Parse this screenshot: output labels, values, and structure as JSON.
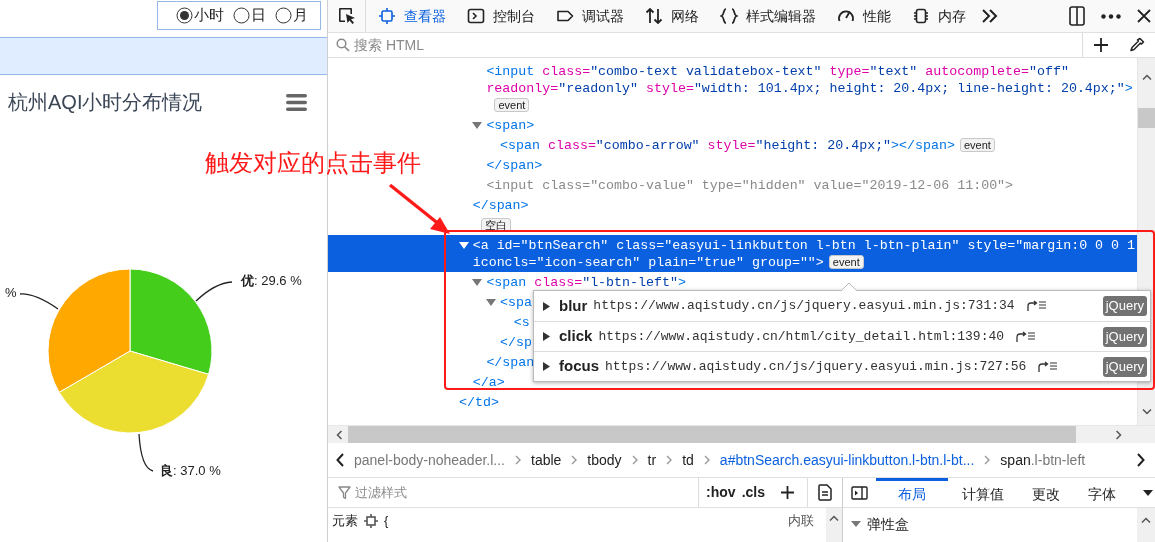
{
  "page": {
    "period_options": [
      {
        "label": "小时",
        "selected": true
      },
      {
        "label": "日",
        "selected": false
      },
      {
        "label": "月",
        "selected": false
      }
    ],
    "chart_title": "杭州AQI小时分布情况",
    "chart_data": {
      "type": "pie",
      "values": [
        29.6,
        37.0,
        33.4
      ],
      "colors": [
        "#44ce1b",
        "#ecdd31",
        "#ffa800"
      ]
    },
    "slice_labels": [
      "**优**: 29.6 %",
      "**良**: 37.0 %",
      "%"
    ]
  },
  "annotation": {
    "text": "触发对应的点击事件"
  },
  "devtools": {
    "tabs": [
      {
        "label": "查看器",
        "kind": "inspector",
        "selected": true
      },
      {
        "label": "控制台",
        "kind": "console",
        "selected": false
      },
      {
        "label": "调试器",
        "kind": "debugger",
        "selected": false
      },
      {
        "label": "网络",
        "kind": "network",
        "selected": false
      },
      {
        "label": "样式编辑器",
        "kind": "style",
        "selected": false
      },
      {
        "label": "性能",
        "kind": "performance",
        "selected": false
      },
      {
        "label": "内存",
        "kind": "memory",
        "selected": false
      }
    ],
    "search": {
      "placeholder": "搜索 HTML"
    },
    "markup": [
      {
        "children": [
          {
            "children": [
              {
                "selected": false,
                "lines": [
                  [
                    {
                      "kind": "tag",
                      "text": "<input"
                    },
                    {
                      "kind": "attr",
                      "text": " class="
                    },
                    {
                      "kind": "val",
                      "text": "\"combo-text validatebox-text\""
                    },
                    {
                      "kind": "attr",
                      "text": " type="
                    },
                    {
                      "kind": "val",
                      "text": "\"text\""
                    },
                    {
                      "kind": "attr",
                      "text": " autocomplete="
                    },
                    {
                      "kind": "val",
                      "text": "\"off\""
                    }
                  ],
                  [
                    {
                      "kind": "attr",
                      "text": "readonly="
                    },
                    {
                      "kind": "val",
                      "text": "\"readonly\""
                    },
                    {
                      "kind": "attr",
                      "text": " style="
                    },
                    {
                      "kind": "val",
                      "text": "\"width: 101.4px; height: 20.4px; line-height: 20.4px;\""
                    },
                    {
                      "kind": "tag",
                      "text": ">"
                    }
                  ],
                  [
                    {
                      "kind": "badge",
                      "text": "event"
                    }
                  ]
                ]
              },
              {
                "selected": false,
                "expanded": true,
                "lines": [
                  [
                    {
                      "kind": "tag",
                      "text": "<span>"
                    }
                  ]
                ],
                "children": [
                  {
                    "selected": false,
                    "lines": [
                      [
                        {
                          "kind": "tag",
                          "text": "<span"
                        },
                        {
                          "kind": "attr",
                          "text": " class="
                        },
                        {
                          "kind": "val",
                          "text": "\"combo-arrow\""
                        },
                        {
                          "kind": "attr",
                          "text": " style="
                        },
                        {
                          "kind": "val",
                          "text": "\"height: 20.4px;\""
                        },
                        {
                          "kind": "tag",
                          "text": "></span>"
                        },
                        {
                          "kind": "badge",
                          "text": "event"
                        }
                      ]
                    ]
                  }
                ],
                "close": [
                  {
                    "kind": "tag",
                    "text": "</span>"
                  }
                ]
              },
              {
                "selected": false,
                "dimmed": true,
                "lines": [
                  [
                    {
                      "kind": "tag",
                      "text": "<input"
                    },
                    {
                      "kind": "attr",
                      "text": " class="
                    },
                    {
                      "kind": "val",
                      "text": "\"combo-value\""
                    },
                    {
                      "kind": "attr",
                      "text": " type="
                    },
                    {
                      "kind": "val",
                      "text": "\"hidden\""
                    },
                    {
                      "kind": "attr",
                      "text": " value="
                    },
                    {
                      "kind": "val",
                      "text": "\"2019-12-06 11:00\""
                    },
                    {
                      "kind": "tag",
                      "text": ">"
                    }
                  ]
                ]
              }
            ],
            "close": [
              {
                "kind": "tag",
                "text": "</span>"
              }
            ]
          },
          {
            "selected": false,
            "lines": [
              [
                {
                  "kind": "badge",
                  "text": "空白"
                }
              ]
            ]
          },
          {
            "selected": true,
            "expanded": true,
            "lines": [
              [
                {
                  "kind": "tag",
                  "text": "<a"
                },
                {
                  "kind": "attr",
                  "text": " id="
                },
                {
                  "kind": "val",
                  "text": "\"btnSearch\""
                },
                {
                  "kind": "attr",
                  "text": " class="
                },
                {
                  "kind": "val",
                  "text": "\"easyui-linkbutton l-btn l-btn-plain\""
                },
                {
                  "kind": "attr",
                  "text": " style="
                },
                {
                  "kind": "val",
                  "text": "\"margin:0 0 0 1"
                }
              ],
              [
                {
                  "kind": "attr",
                  "text": "iconcls="
                },
                {
                  "kind": "val",
                  "text": "\"icon-search\""
                },
                {
                  "kind": "attr",
                  "text": " plain="
                },
                {
                  "kind": "val",
                  "text": "\"true\""
                },
                {
                  "kind": "attr",
                  "text": " group="
                },
                {
                  "kind": "val",
                  "text": "\"\""
                },
                {
                  "kind": "tag",
                  "text": ">"
                },
                {
                  "kind": "badge",
                  "text": "event"
                }
              ]
            ],
            "children": [
              {
                "selected": false,
                "expanded": true,
                "lines": [
                  [
                    {
                      "kind": "tag",
                      "text": "<span"
                    },
                    {
                      "kind": "attr",
                      "text": " class="
                    },
                    {
                      "kind": "val",
                      "text": "\"l-btn-left\""
                    },
                    {
                      "kind": "tag",
                      "text": ">"
                    }
                  ]
                ],
                "children": [
                  {
                    "selected": false,
                    "expanded": true,
                    "lines": [
                      [
                        {
                          "kind": "tag",
                          "text": "<spa"
                        }
                      ]
                    ],
                    "children": [
                      {
                        "selected": false,
                        "lines": [
                          [
                            {
                              "kind": "tag",
                              "text": "<s"
                            }
                          ]
                        ]
                      }
                    ],
                    "close": [
                      {
                        "kind": "tag",
                        "text": "</sp"
                      }
                    ]
                  }
                ],
                "close": [
                  {
                    "kind": "tag",
                    "text": "</span"
                  }
                ]
              }
            ],
            "close": [
              {
                "kind": "tag",
                "text": "</a>"
              }
            ]
          }
        ],
        "close": [
          {
            "kind": "tag",
            "text": "</td>"
          }
        ]
      }
    ],
    "event_popup": [
      {
        "event": "blur",
        "source": "https://www.aqistudy.cn/js/jquery.easyui.min.js:731:34",
        "framework": "jQuery",
        "expanded": false
      },
      {
        "event": "click",
        "source": "https://www.aqistudy.cn/html/city_detail.html:139:40",
        "framework": "jQuery",
        "expanded": false
      },
      {
        "event": "focus",
        "source": "https://www.aqistudy.cn/js/jquery.easyui.min.js:727:56",
        "framework": "jQuery",
        "expanded": false
      }
    ],
    "breadcrumbs": [
      {
        "classes": "panel-body-noheader.l...",
        "selected": false
      },
      {
        "tag": "table",
        "selected": false
      },
      {
        "tag": "tbody",
        "selected": false
      },
      {
        "tag": "tr",
        "selected": false
      },
      {
        "tag": "td",
        "selected": false
      },
      {
        "tag": "a#btnSearch",
        "classes": ".easyui-linkbutton.l-btn.l-bt...",
        "selected": true
      },
      {
        "tag": "span",
        "classes": ".l-btn-left",
        "selected": false
      }
    ],
    "rules_pane": {
      "filter_placeholder": "过滤样式",
      "toggles": [
        ":hov",
        ".cls"
      ],
      "selector": "元素",
      "brace": "{",
      "source": "内联"
    },
    "layout_pane": {
      "tabs": [
        {
          "label": "布局",
          "selected": true
        },
        {
          "label": "计算值",
          "selected": false
        },
        {
          "label": "更改",
          "selected": false
        },
        {
          "label": "字体",
          "selected": false
        }
      ],
      "section": {
        "label": "弹性盒",
        "expanded": true
      }
    }
  }
}
